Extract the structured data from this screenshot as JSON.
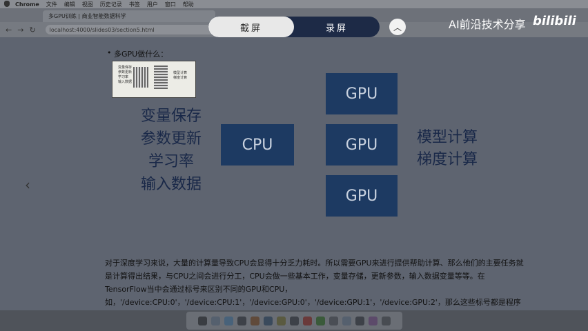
{
  "menubar": {
    "app": "Chrome",
    "items": [
      "文件",
      "编辑",
      "视图",
      "历史记录",
      "书签",
      "用户",
      "窗口",
      "帮助"
    ]
  },
  "tab": {
    "title": "多GPU训练 | 商业智能数据科学"
  },
  "address": {
    "url": "localhost:4000/slides03/section5.html"
  },
  "capture": {
    "screenshot_label": "截屏",
    "record_label": "录屏"
  },
  "watermark": {
    "text": "AI前沿技术分享",
    "logo": "bilibili"
  },
  "slide": {
    "bullet": "多GPU做什么：",
    "thumb_left": [
      "变量保存",
      "参数更新",
      "学习率",
      "输入数据"
    ],
    "thumb_right": [
      "模型计算",
      "梯度计算"
    ],
    "left_items": [
      "变量保存",
      "参数更新",
      "学习率",
      "输入数据"
    ],
    "cpu_label": "CPU",
    "gpu_labels": [
      "GPU",
      "GPU",
      "GPU"
    ],
    "right_items": [
      "模型计算",
      "梯度计算"
    ],
    "prev_icon": "chevron-left-icon",
    "paragraph": "对于深度学习来说，大量的计算量导致CPU会显得十分乏力耗时。所以需要GPU来进行提供帮助计算、那么他们的主要任务就是计算得出结果，与CPU之间会进行分工，CPU会做一些基本工作，变量存储，更新参数，输入数据变量等等。在TensorFlow当中会通过标号来区别不同的GPU和CPU，如，'/device:CPU:0'，'/device:CPU:1'，'/device:GPU:0'，'/device:GPU:1'，'/device:GPU:2'，那么这些标号都是程序自动给的编号，指的具体实际计算设备"
  },
  "colors": {
    "box": "#1d3a62",
    "dim": "#5e6470"
  }
}
